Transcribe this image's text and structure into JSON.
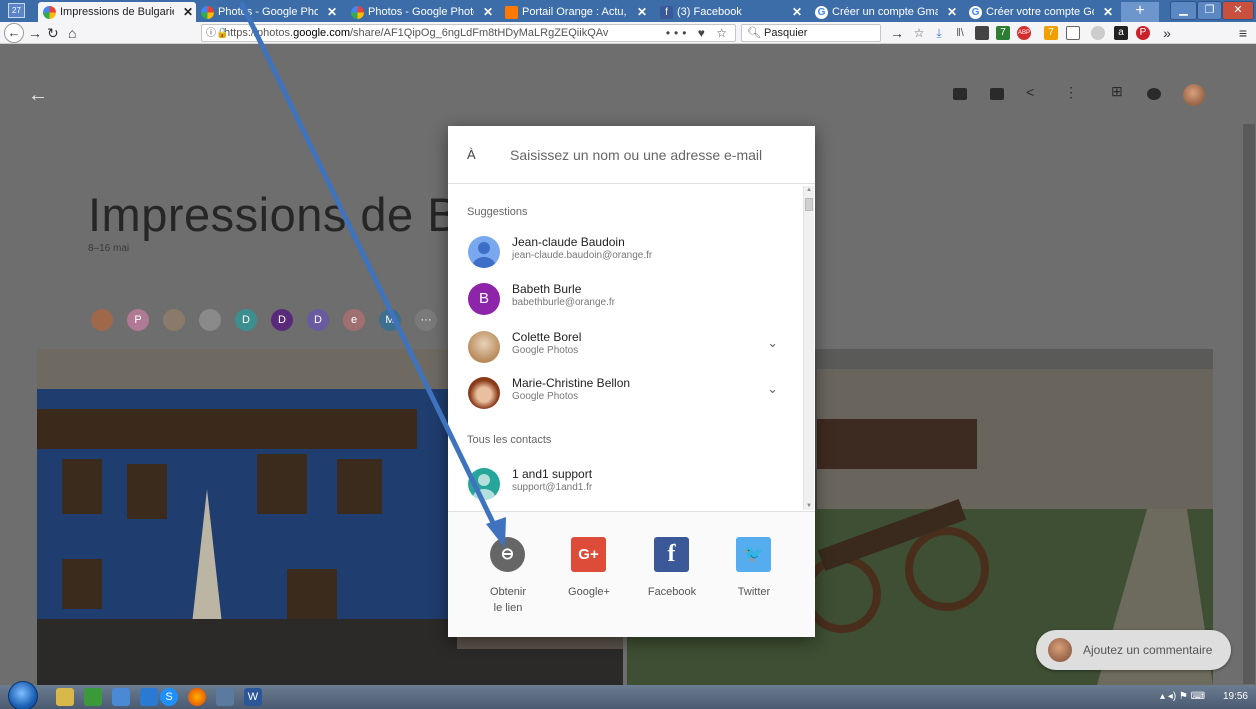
{
  "browser": {
    "tabs": [
      {
        "label": "Impressions de Bulgarie",
        "active": true,
        "icon": "google-photos-icon"
      },
      {
        "label": "Photos - Google Photos",
        "active": false,
        "icon": "google-photos-icon"
      },
      {
        "label": "Photos - Google Photos",
        "active": false,
        "icon": "google-photos-icon"
      },
      {
        "label": "Portail Orange : Actu, Sp",
        "active": false,
        "icon": "orange-icon"
      },
      {
        "label": "(3) Facebook",
        "active": false,
        "icon": "facebook-icon"
      },
      {
        "label": "Créer un compte Gmail",
        "active": false,
        "icon": "google-icon"
      },
      {
        "label": "Créer votre compte Goo",
        "active": false,
        "icon": "google-icon"
      }
    ],
    "close_glyph": "✕",
    "new_tab_glyph": "+",
    "url": {
      "prefix": "https://photos.",
      "domain": "google.com",
      "path": "/share/AF1QipOg_6ngLdFm8tHDyMaLRgZEQiikQAv"
    },
    "url_actions": "••• ♥ ☆",
    "search_value": "Pasquier",
    "search_go": "→",
    "calendar_badge": "27",
    "toolbar_badge_a": "7",
    "toolbar_badge_b": "7"
  },
  "page": {
    "album_title": "Impressions de Bulgarie",
    "album_dates": "8–16 mai",
    "shared_faces": [
      {
        "letter": "",
        "color": "#a0684a"
      },
      {
        "letter": "P",
        "color": "#b07a94"
      },
      {
        "letter": "",
        "color": "#8a7a6a"
      },
      {
        "letter": "",
        "color": "#8a8a8a"
      },
      {
        "letter": "D",
        "color": "#3d8f8f"
      },
      {
        "letter": "D",
        "color": "#5a2a7a"
      },
      {
        "letter": "D",
        "color": "#6a5aa0"
      },
      {
        "letter": "e",
        "color": "#a07070"
      },
      {
        "letter": "M",
        "color": "#3d6f8f"
      },
      {
        "letter": "···",
        "color": "#7a7a7a"
      }
    ],
    "comment_placeholder": "Ajoutez un commentaire"
  },
  "share_dialog": {
    "to_label": "À",
    "input_placeholder": "Saisissez un nom ou une adresse e-mail",
    "suggestions_label": "Suggestions",
    "all_contacts_label": "Tous les contacts",
    "suggestions": [
      {
        "name": "Jean-claude Baudoin",
        "sub": "jean-claude.baudoin@orange.fr",
        "avatar_letter": "",
        "avatar_color": "#6a9ae0",
        "expandable": false
      },
      {
        "name": "Babeth Burle",
        "sub": "babethburle@orange.fr",
        "avatar_letter": "B",
        "avatar_color": "#8e24aa",
        "expandable": false
      },
      {
        "name": "Colette Borel",
        "sub": "Google Photos",
        "avatar_letter": "",
        "avatar_color": "#b88a5a",
        "expandable": true
      },
      {
        "name": "Marie-Christine Bellon",
        "sub": "Google Photos",
        "avatar_letter": "",
        "avatar_color": "#a0522d",
        "expandable": true
      }
    ],
    "contacts": [
      {
        "name": "1 and1 support",
        "sub": "support@1and1.fr",
        "avatar_letter": "",
        "avatar_color": "#26a69a",
        "expandable": false
      }
    ],
    "share_options": [
      {
        "label": "Obtenir le lien",
        "glyph": "⊖",
        "color": "#666666",
        "icon": "link-icon"
      },
      {
        "label": "Google+",
        "glyph": "G+",
        "color": "#dd4b39",
        "icon": "google-plus-icon"
      },
      {
        "label": "Facebook",
        "glyph": "f",
        "color": "#3b5998",
        "icon": "facebook-icon"
      },
      {
        "label": "Twitter",
        "glyph": "🐦",
        "color": "#55acee",
        "icon": "twitter-icon"
      }
    ]
  },
  "annotation": {
    "type": "arrow",
    "color": "#3f73bd"
  },
  "taskbar": {
    "clock": "19:56"
  }
}
